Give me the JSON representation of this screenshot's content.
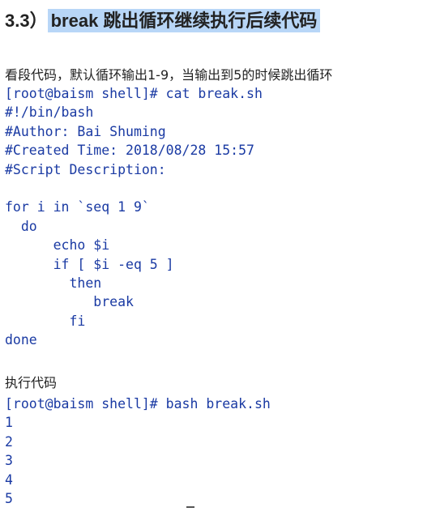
{
  "heading": {
    "number": "3.3）",
    "title": "break 跳出循环继续执行后续代码"
  },
  "intro_text": "看段代码，默认循环输出1-9，当输出到5的时候跳出循环",
  "script_block": {
    "lines": [
      "[root@baism shell]# cat break.sh",
      "#!/bin/bash",
      "#Author: Bai Shuming",
      "#Created Time: 2018/08/28 15:57",
      "#Script Description:",
      "",
      "for i in `seq 1 9`",
      "  do",
      "      echo $i",
      "      if [ $i -eq 5 ]",
      "        then",
      "           break",
      "        fi",
      "done"
    ]
  },
  "run_text": "执行代码",
  "output_block": {
    "lines": [
      "[root@baism shell]# bash break.sh",
      "1",
      "2",
      "3",
      "4",
      "5"
    ]
  },
  "colors": {
    "code_text": "#1a3aa3",
    "heading_highlight": "#b8d6f7",
    "body_text": "#222222"
  }
}
